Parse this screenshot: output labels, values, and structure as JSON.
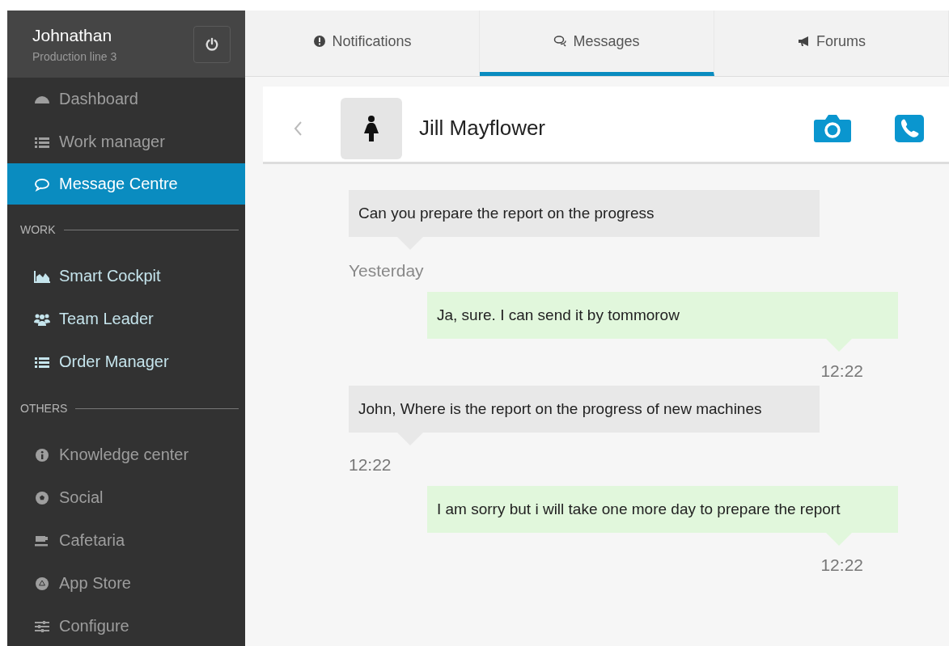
{
  "user": {
    "name": "Johnathan",
    "subtitle": "Production line 3"
  },
  "sidebar": {
    "groups": [
      {
        "items": [
          {
            "label": "Dashboard",
            "selected": false
          },
          {
            "label": "Work manager",
            "selected": false
          },
          {
            "label": "Message Centre",
            "selected": true
          }
        ]
      },
      {
        "heading": "WORK",
        "items": [
          {
            "label": "Smart Cockpit",
            "selected": false
          },
          {
            "label": "Team Leader",
            "selected": false
          },
          {
            "label": "Order Manager",
            "selected": false
          }
        ]
      },
      {
        "heading": "OTHERS",
        "items": [
          {
            "label": "Knowledge center",
            "selected": false
          },
          {
            "label": "Social",
            "selected": false
          },
          {
            "label": "Cafetaria",
            "selected": false
          },
          {
            "label": "App Store",
            "selected": false
          },
          {
            "label": "Configure",
            "selected": false
          }
        ]
      }
    ]
  },
  "tabs": [
    {
      "label": "Notifications",
      "selected": false
    },
    {
      "label": "Messages",
      "selected": true
    },
    {
      "label": "Forums",
      "selected": false
    }
  ],
  "contact": {
    "name": "Jill Mayflower"
  },
  "messages": [
    {
      "kind": "incoming",
      "text": "Can you prepare the report on the progress"
    },
    {
      "kind": "divider",
      "text": "Yesterday"
    },
    {
      "kind": "outgoing",
      "text": "Ja, sure. I can send it by tommorow",
      "time": "12:22"
    },
    {
      "kind": "incoming",
      "text": "John, Where is the report on the progress of new machines",
      "time": "12:22"
    },
    {
      "kind": "outgoing",
      "text": "I am sorry but i will take one more day to prepare the report",
      "time": "12:22"
    }
  ]
}
